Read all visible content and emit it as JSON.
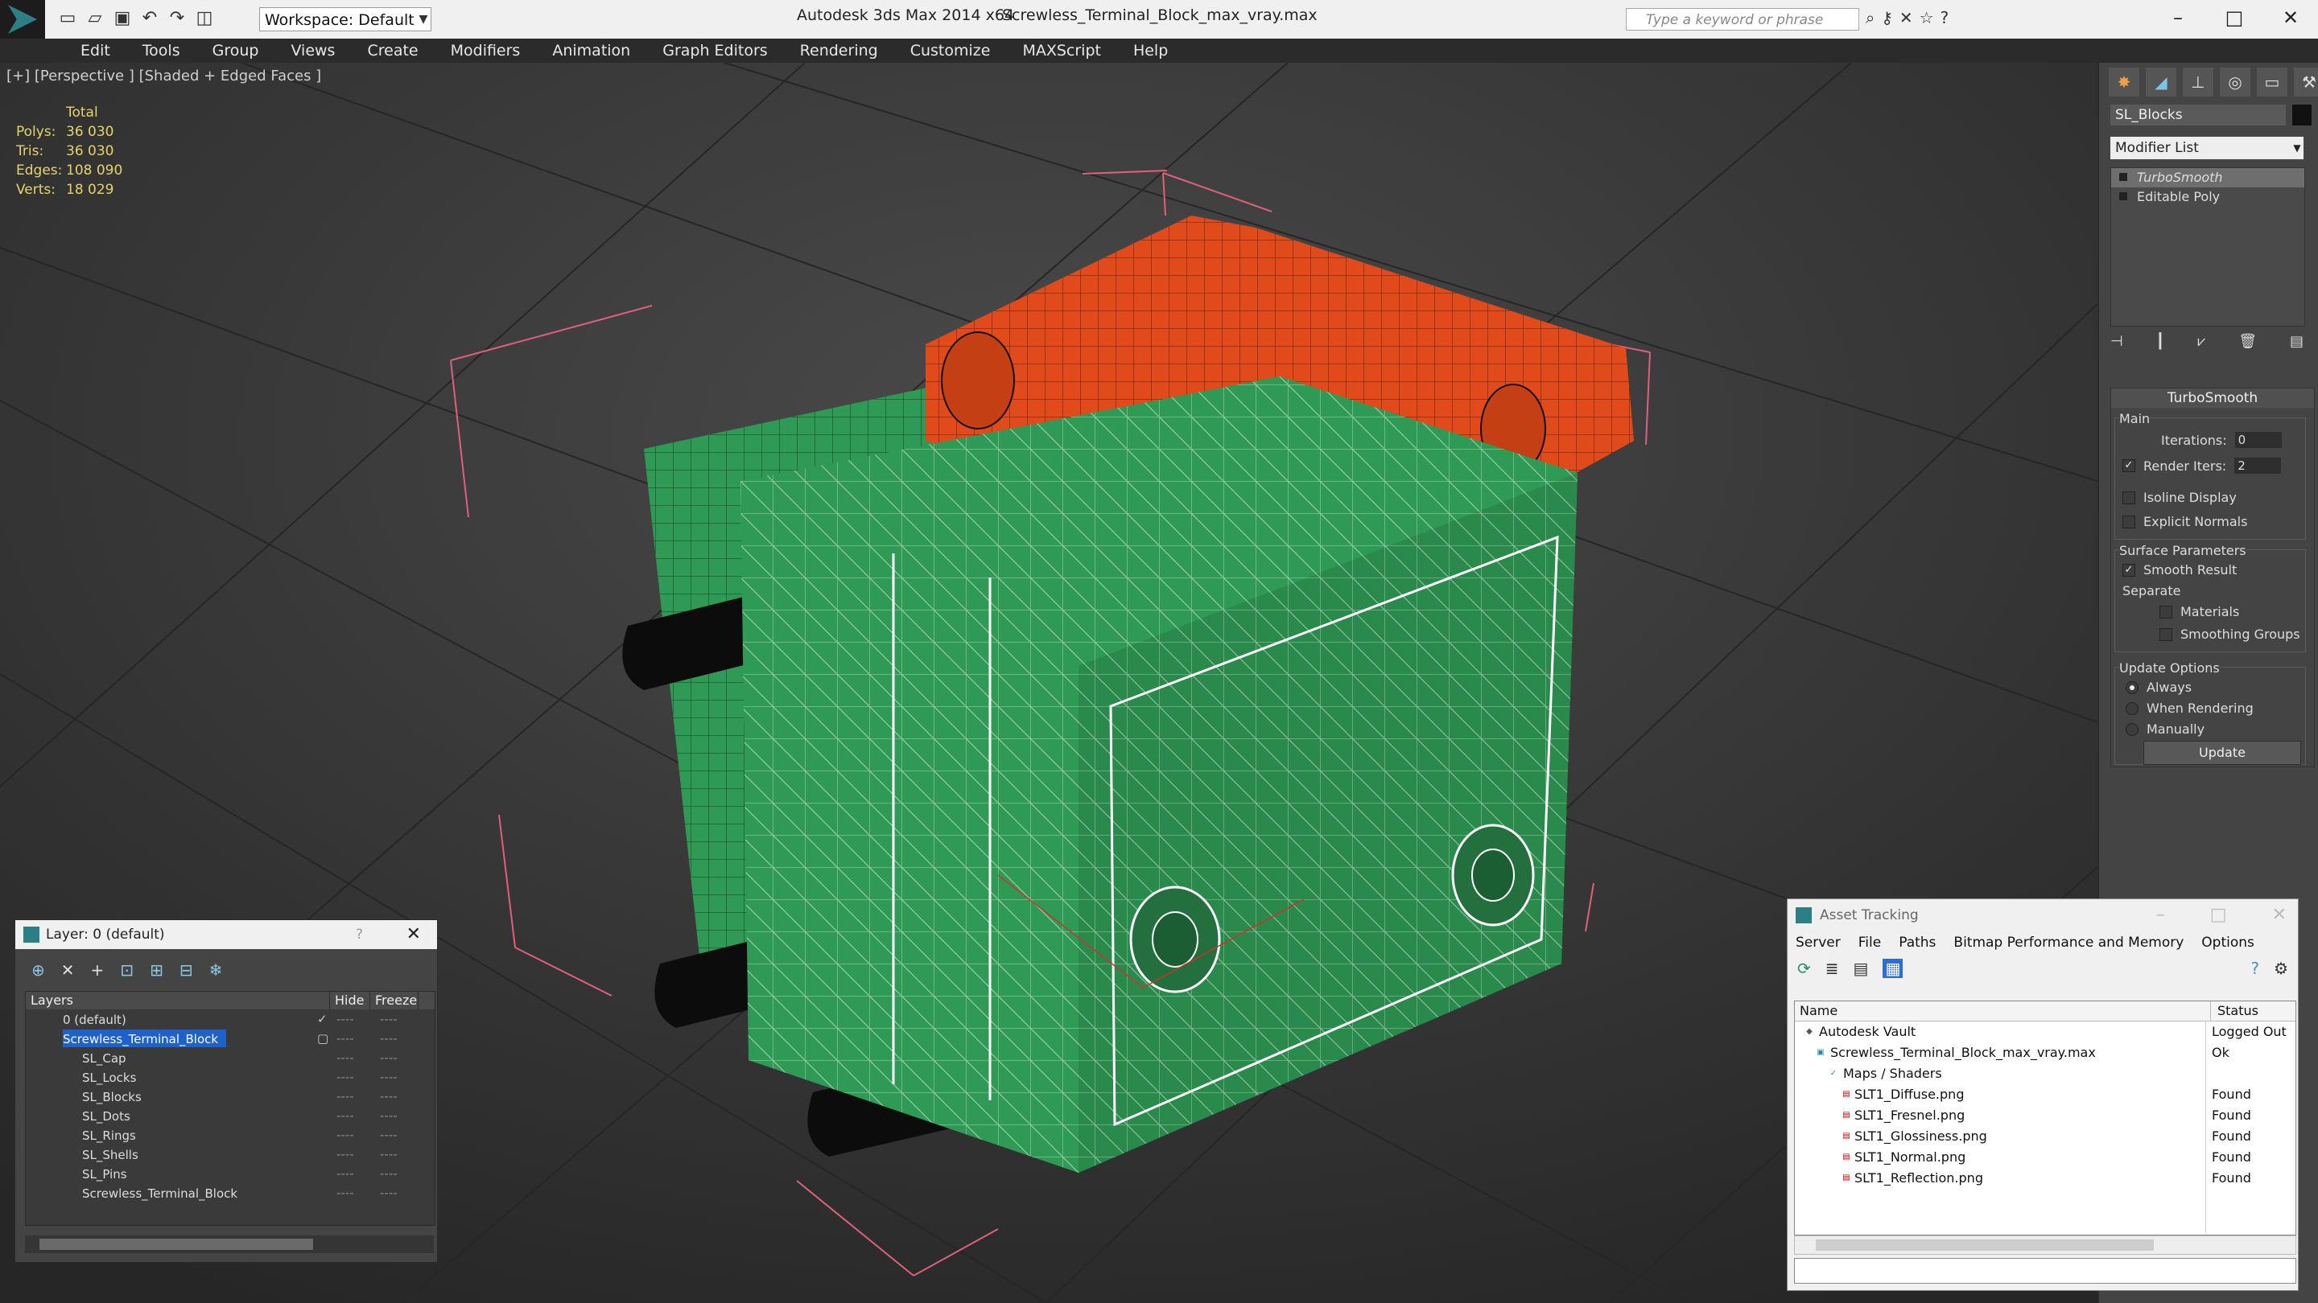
{
  "titlebar": {
    "app_title": "Autodesk 3ds Max  2014 x64",
    "file_title": "Screwless_Terminal_Block_max_vray.max",
    "workspace": "Workspace: Default",
    "search_placeholder": "Type a keyword or phrase"
  },
  "menu": [
    "Edit",
    "Tools",
    "Group",
    "Views",
    "Create",
    "Modifiers",
    "Animation",
    "Graph Editors",
    "Rendering",
    "Customize",
    "MAXScript",
    "Help"
  ],
  "viewport": {
    "label": "[+] [Perspective ] [Shaded + Edged Faces ]",
    "stats": {
      "header": "Total",
      "rows": [
        {
          "k": "Polys:",
          "v": "36 030"
        },
        {
          "k": "Tris:",
          "v": "36 030"
        },
        {
          "k": "Edges:",
          "v": "108 090"
        },
        {
          "k": "Verts:",
          "v": "18 029"
        }
      ]
    }
  },
  "command_panel": {
    "object_name": "SL_Blocks",
    "modifier_list": "Modifier List",
    "stack": [
      "TurboSmooth",
      "Editable Poly"
    ],
    "rollout_title": "TurboSmooth",
    "main_label": "Main",
    "iterations_label": "Iterations:",
    "iterations_value": "0",
    "render_iters_label": "Render Iters:",
    "render_iters_value": "2",
    "isoline": "Isoline Display",
    "explicit_normals": "Explicit Normals",
    "surface_params": "Surface Parameters",
    "smooth_result": "Smooth Result",
    "separate": "Separate",
    "materials": "Materials",
    "smoothing_groups": "Smoothing Groups",
    "update_options": "Update Options",
    "always": "Always",
    "when_rendering": "When Rendering",
    "manually": "Manually",
    "update_button": "Update"
  },
  "layer_window": {
    "title": "Layer: 0 (default)",
    "help": "?",
    "columns": [
      "Layers",
      "Hide",
      "Freeze"
    ],
    "rows": [
      {
        "name": "0 (default)",
        "indent": 1
      },
      {
        "name": "Screwless_Terminal_Block",
        "indent": 1
      },
      {
        "name": "SL_Cap",
        "indent": 2
      },
      {
        "name": "SL_Locks",
        "indent": 2
      },
      {
        "name": "SL_Blocks",
        "indent": 2
      },
      {
        "name": "SL_Dots",
        "indent": 2
      },
      {
        "name": "SL_Rings",
        "indent": 2
      },
      {
        "name": "SL_Shells",
        "indent": 2
      },
      {
        "name": "SL_Pins",
        "indent": 2
      },
      {
        "name": "Screwless_Terminal_Block",
        "indent": 2
      }
    ],
    "dash": "----",
    "check": "✓"
  },
  "asset_window": {
    "title": "Asset Tracking",
    "menu": [
      "Server",
      "File",
      "Paths",
      "Bitmap Performance and Memory",
      "Options"
    ],
    "columns": [
      "Name",
      "Status"
    ],
    "rows": [
      {
        "name": "Autodesk Vault",
        "status": "Logged Out",
        "indent": 1
      },
      {
        "name": "Screwless_Terminal_Block_max_vray.max",
        "status": "Ok",
        "indent": 2
      },
      {
        "name": "Maps / Shaders",
        "status": "",
        "indent": 3
      },
      {
        "name": "SLT1_Diffuse.png",
        "status": "Found",
        "indent": 4
      },
      {
        "name": "SLT1_Fresnel.png",
        "status": "Found",
        "indent": 4
      },
      {
        "name": "SLT1_Glossiness.png",
        "status": "Found",
        "indent": 4
      },
      {
        "name": "SLT1_Normal.png",
        "status": "Found",
        "indent": 4
      },
      {
        "name": "SLT1_Reflection.png",
        "status": "Found",
        "indent": 4
      }
    ]
  },
  "colors": {
    "block_green": "#2f9a55",
    "lock_orange": "#e14b1b",
    "pin_black": "#0c0c0c",
    "selection_blue": "#1e62c9"
  }
}
